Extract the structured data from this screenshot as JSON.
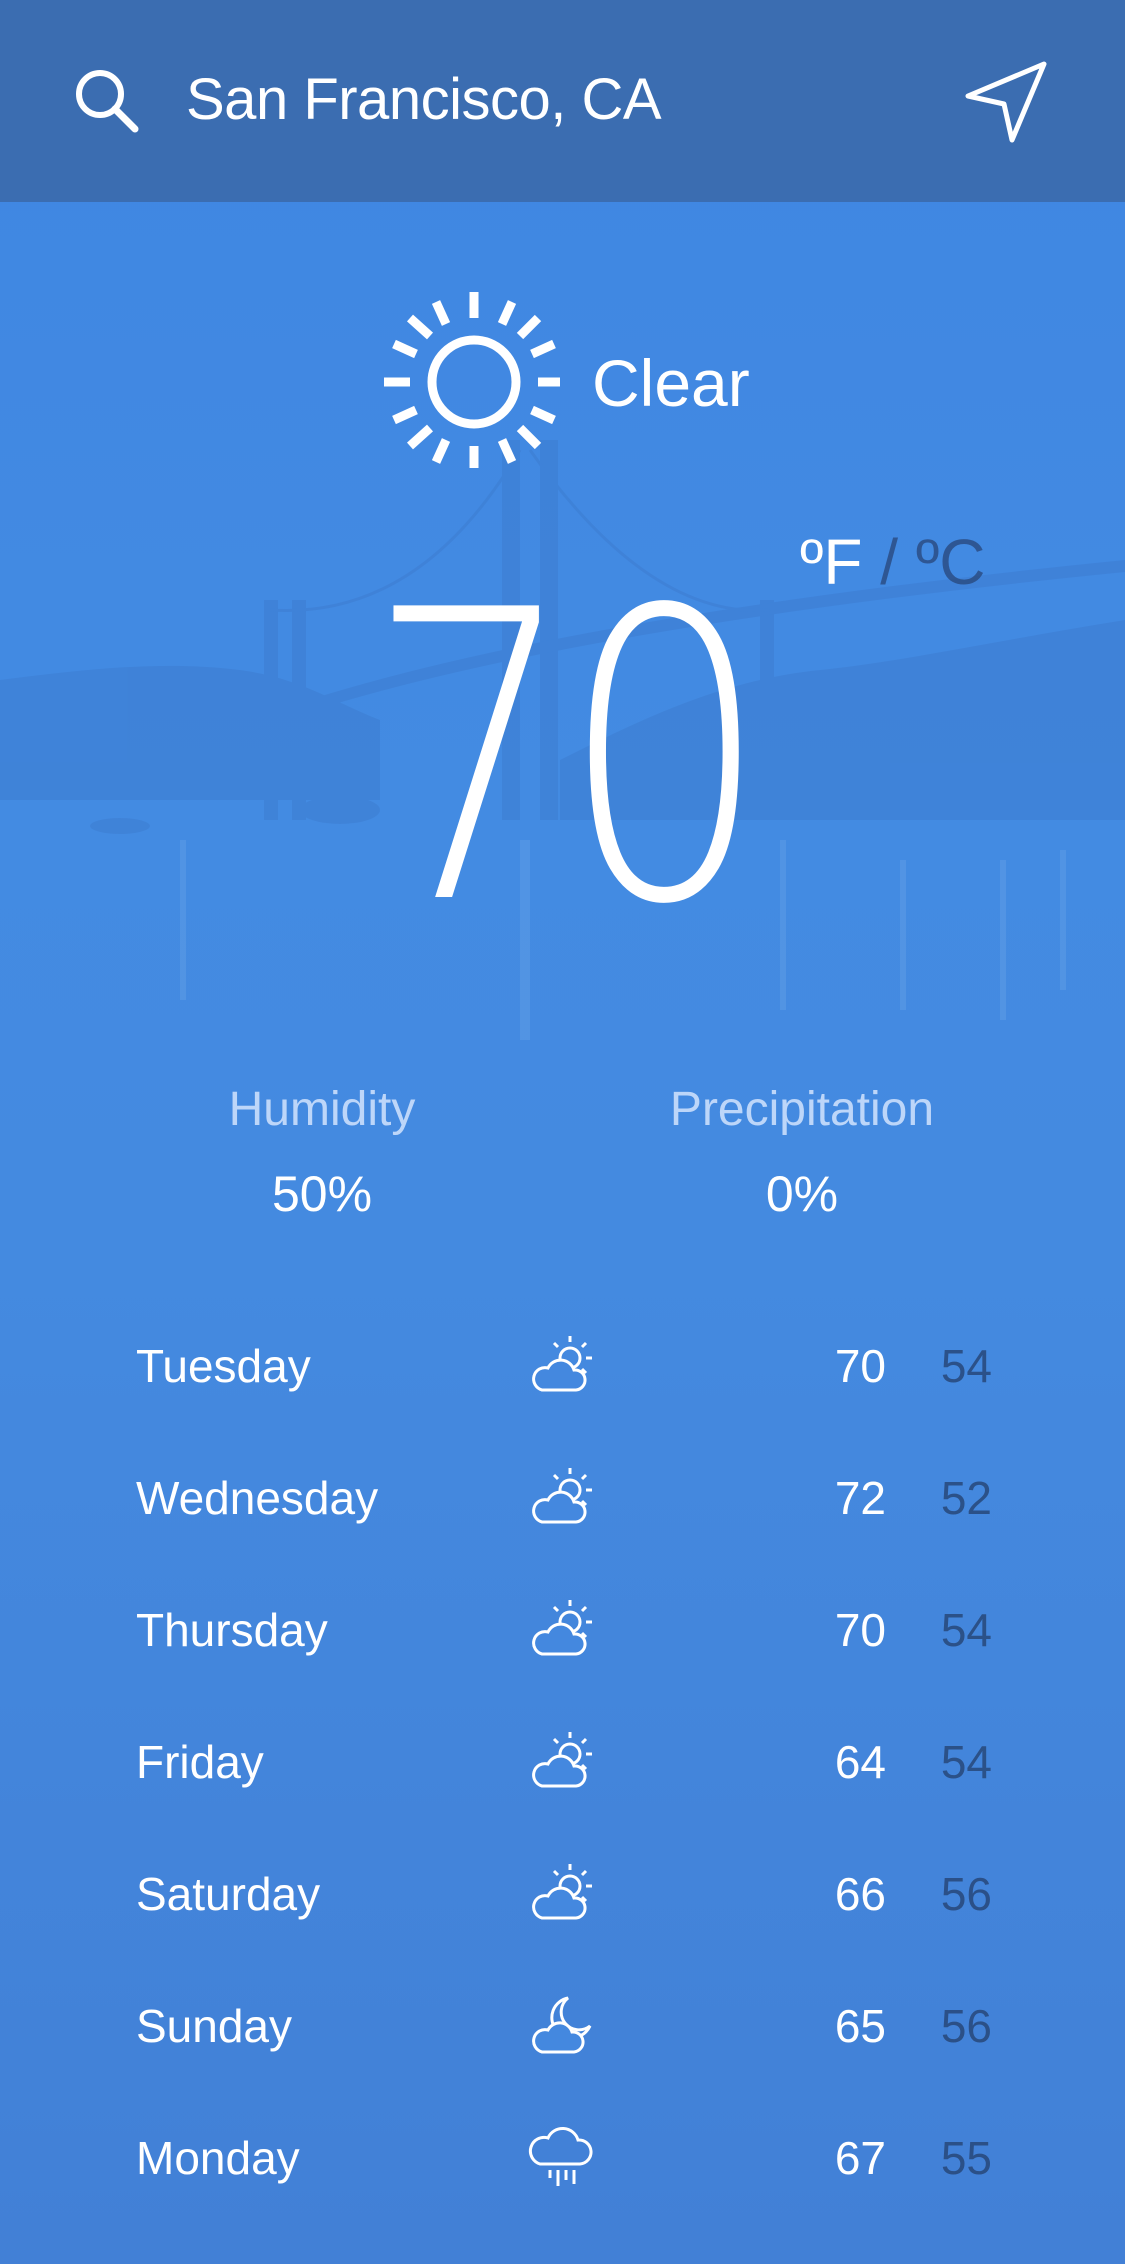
{
  "header": {
    "city": "San Francisco, CA",
    "search_icon": "search-icon",
    "location_icon": "location-arrow-icon",
    "background": "#3b6db1"
  },
  "current": {
    "condition": "Clear",
    "icon": "sun-icon",
    "temperature": "70",
    "unit_f": "ºF",
    "unit_separator": "/",
    "unit_c": "ºC"
  },
  "stats": {
    "humidity_label": "Humidity",
    "humidity_value": "50%",
    "precipitation_label": "Precipitation",
    "precipitation_value": "0%"
  },
  "forecast": [
    {
      "day": "Tuesday",
      "icon": "partly-cloudy-day-icon",
      "high": "70",
      "low": "54"
    },
    {
      "day": "Wednesday",
      "icon": "partly-cloudy-day-icon",
      "high": "72",
      "low": "52"
    },
    {
      "day": "Thursday",
      "icon": "partly-cloudy-day-icon",
      "high": "70",
      "low": "54"
    },
    {
      "day": "Friday",
      "icon": "partly-cloudy-day-icon",
      "high": "64",
      "low": "54"
    },
    {
      "day": "Saturday",
      "icon": "partly-cloudy-day-icon",
      "high": "66",
      "low": "56"
    },
    {
      "day": "Sunday",
      "icon": "partly-cloudy-night-icon",
      "high": "65",
      "low": "56"
    },
    {
      "day": "Monday",
      "icon": "rain-icon",
      "high": "67",
      "low": "55"
    }
  ],
  "colors": {
    "background_top": "#3f86e2",
    "background_bottom": "#4280d6",
    "low_temp": "#264473"
  }
}
